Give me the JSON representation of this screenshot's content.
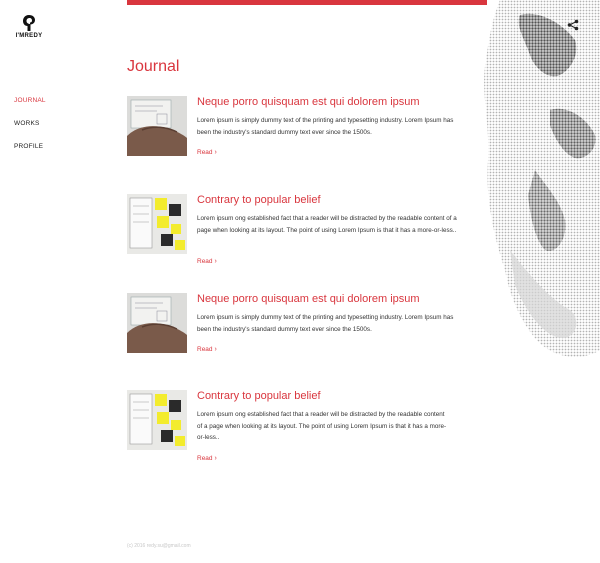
{
  "brand": {
    "name": "I'MREDY"
  },
  "nav": {
    "items": [
      {
        "label": "JOURNAL",
        "active": true
      },
      {
        "label": "WORKS",
        "active": false
      },
      {
        "label": "PROFILE",
        "active": false
      }
    ]
  },
  "header": {
    "share_icon": "share-icon"
  },
  "page": {
    "title": "Journal"
  },
  "posts": [
    {
      "title": "Neque porro quisquam est qui dolorem ipsum",
      "excerpt": "Lorem ipsum is simply dummy text of the printing and typesetting industry. Lorem Ipsum has been the industry's standard dummy text ever since the 1500s.",
      "read_label": "Read",
      "thumb": "hand-sketching-wireframe"
    },
    {
      "title": "Contrary to popular belief",
      "excerpt": "Lorem ipsum ong established fact that a reader will be distracted by the readable content of a page when looking at its layout. The point of using Lorem Ipsum is that it has a more-or-less..",
      "read_label": "Read",
      "thumb": "sticky-notes-wireframe"
    },
    {
      "title": "Neque porro quisquam est qui dolorem ipsum",
      "excerpt": "Lorem ipsum is simply dummy text of the printing and typesetting industry. Lorem Ipsum has been the industry's standard dummy text ever since the 1500s.",
      "read_label": "Read",
      "thumb": "hand-sketching-wireframe"
    },
    {
      "title": "Contrary to popular belief",
      "excerpt": "Lorem ipsum ong established fact that a reader will be distracted by the readable content of a page when looking at its layout. The point of using Lorem Ipsum is that it has a more-or-less..",
      "read_label": "Read",
      "thumb": "sticky-notes-wireframe"
    }
  ],
  "footer": {
    "text": "(c) 2016 redy.su@gmail.com"
  },
  "colors": {
    "accent": "#d9363e",
    "text": "#222222",
    "muted": "#c8c8c8"
  }
}
